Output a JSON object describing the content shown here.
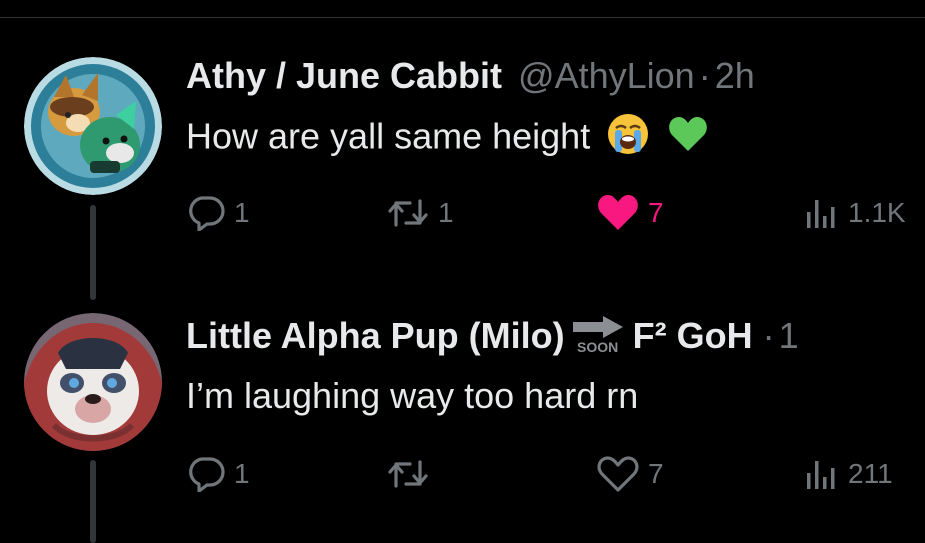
{
  "replies": [
    {
      "display_name": "Athy / June Cabbit",
      "handle": "@AthyLion",
      "separator": "·",
      "time": "2h",
      "text": "How are yall same height",
      "emojis": [
        "loudly-crying-face",
        "green-heart"
      ],
      "metrics": {
        "replies": "1",
        "reposts": "1",
        "likes": "7",
        "views": "1.1K"
      },
      "liked": true
    },
    {
      "display_name": "Little Alpha Pup (Milo)",
      "badge_text": "SOON",
      "name_suffix": "F² GoH",
      "separator": "·",
      "time": "1",
      "text": "I’m laughing way too hard rn",
      "metrics": {
        "replies": "1",
        "reposts": "",
        "likes": "7",
        "views": "211"
      },
      "liked": false
    }
  ],
  "colors": {
    "like_active": "#f91880",
    "muted": "#71767b",
    "text": "#e7e9ea",
    "background": "#000000"
  }
}
